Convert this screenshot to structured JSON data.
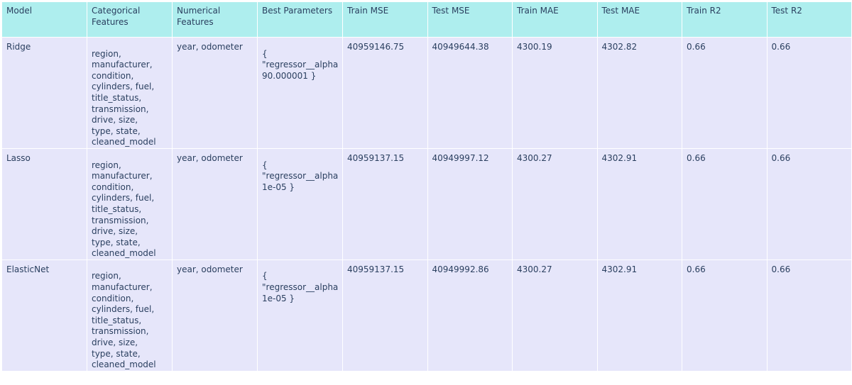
{
  "chart_data": {
    "type": "table",
    "columns": [
      "Model",
      "Categorical\nFeatures",
      "Numerical\nFeatures",
      "Best Parameters",
      "Train MSE",
      "Test MSE",
      "Train MAE",
      "Test MAE",
      "Train R2",
      "Test R2"
    ],
    "rows": [
      {
        "model": "Ridge",
        "categorical": "\nregion,\nmanufacturer,\ncondition,\ncylinders, fuel,\ntitle_status,\ntransmission,\ndrive, size,\ntype, state,\ncleaned_model",
        "numerical": "year, odometer",
        "best_params": "\n{\n\"regressor__alpha\n90.000001 }",
        "train_mse": "40959146.75",
        "test_mse": "40949644.38",
        "train_mae": "4300.19",
        "test_mae": "4302.82",
        "train_r2": "0.66",
        "test_r2": "0.66"
      },
      {
        "model": "Lasso",
        "categorical": "\nregion,\nmanufacturer,\ncondition,\ncylinders, fuel,\ntitle_status,\ntransmission,\ndrive, size,\ntype, state,\ncleaned_model",
        "numerical": "year, odometer",
        "best_params": "\n{\n\"regressor__alpha\n1e-05 }",
        "train_mse": "40959137.15",
        "test_mse": "40949997.12",
        "train_mae": "4300.27",
        "test_mae": "4302.91",
        "train_r2": "0.66",
        "test_r2": "0.66"
      },
      {
        "model": "ElasticNet",
        "categorical": "\nregion,\nmanufacturer,\ncondition,\ncylinders, fuel,\ntitle_status,\ntransmission,\ndrive, size,\ntype, state,\ncleaned_model",
        "numerical": "year, odometer",
        "best_params": "\n{\n\"regressor__alpha\n1e-05 }",
        "train_mse": "40959137.15",
        "test_mse": "40949992.86",
        "train_mae": "4300.27",
        "test_mae": "4302.91",
        "train_r2": "0.66",
        "test_r2": "0.66"
      }
    ],
    "header_color": "#aeeeee",
    "cell_color": "#e6e6fa",
    "text_color": "#2a3f5f"
  }
}
